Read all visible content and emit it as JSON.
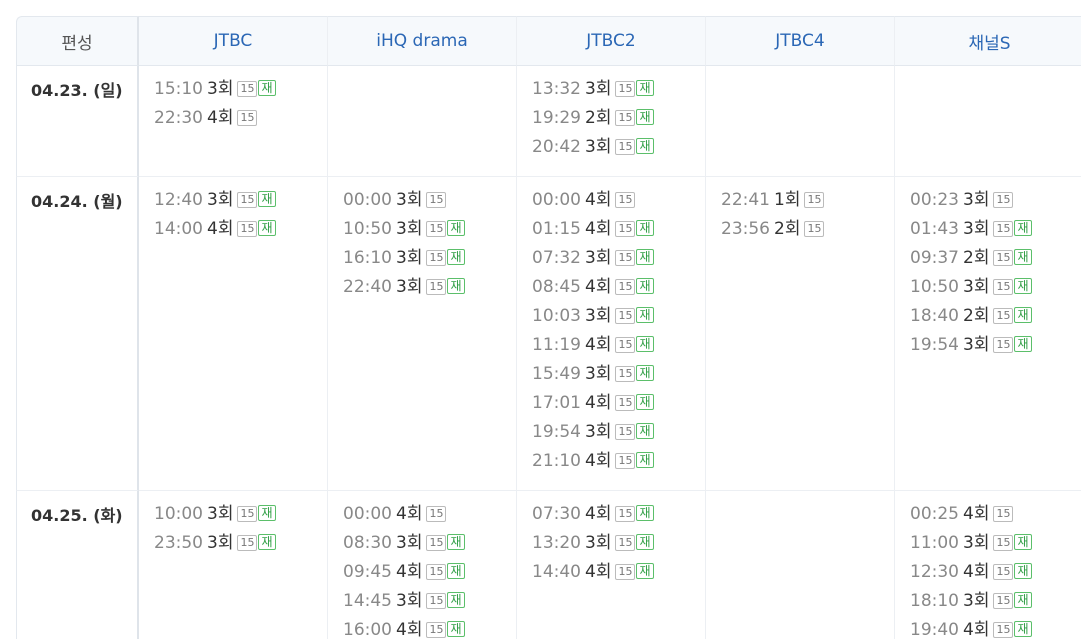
{
  "header": {
    "date_col": "편성",
    "channels": [
      "JTBC",
      "iHQ drama",
      "JTBC2",
      "JTBC4",
      "채널S"
    ]
  },
  "rows": [
    {
      "date": "04.23. (일)",
      "cells": [
        [
          {
            "time": "15:10",
            "ep": "3회",
            "rating": "15",
            "rerun": "재"
          },
          {
            "time": "22:30",
            "ep": "4회",
            "rating": "15"
          }
        ],
        [],
        [
          {
            "time": "13:32",
            "ep": "3회",
            "rating": "15",
            "rerun": "재"
          },
          {
            "time": "19:29",
            "ep": "2회",
            "rating": "15",
            "rerun": "재"
          },
          {
            "time": "20:42",
            "ep": "3회",
            "rating": "15",
            "rerun": "재"
          }
        ],
        [],
        []
      ]
    },
    {
      "date": "04.24. (월)",
      "cells": [
        [
          {
            "time": "12:40",
            "ep": "3회",
            "rating": "15",
            "rerun": "재"
          },
          {
            "time": "14:00",
            "ep": "4회",
            "rating": "15",
            "rerun": "재"
          }
        ],
        [
          {
            "time": "00:00",
            "ep": "3회",
            "rating": "15"
          },
          {
            "time": "10:50",
            "ep": "3회",
            "rating": "15",
            "rerun": "재"
          },
          {
            "time": "16:10",
            "ep": "3회",
            "rating": "15",
            "rerun": "재"
          },
          {
            "time": "22:40",
            "ep": "3회",
            "rating": "15",
            "rerun": "재"
          }
        ],
        [
          {
            "time": "00:00",
            "ep": "4회",
            "rating": "15"
          },
          {
            "time": "01:15",
            "ep": "4회",
            "rating": "15",
            "rerun": "재"
          },
          {
            "time": "07:32",
            "ep": "3회",
            "rating": "15",
            "rerun": "재"
          },
          {
            "time": "08:45",
            "ep": "4회",
            "rating": "15",
            "rerun": "재"
          },
          {
            "time": "10:03",
            "ep": "3회",
            "rating": "15",
            "rerun": "재"
          },
          {
            "time": "11:19",
            "ep": "4회",
            "rating": "15",
            "rerun": "재"
          },
          {
            "time": "15:49",
            "ep": "3회",
            "rating": "15",
            "rerun": "재"
          },
          {
            "time": "17:01",
            "ep": "4회",
            "rating": "15",
            "rerun": "재"
          },
          {
            "time": "19:54",
            "ep": "3회",
            "rating": "15",
            "rerun": "재"
          },
          {
            "time": "21:10",
            "ep": "4회",
            "rating": "15",
            "rerun": "재"
          }
        ],
        [
          {
            "time": "22:41",
            "ep": "1회",
            "rating": "15"
          },
          {
            "time": "23:56",
            "ep": "2회",
            "rating": "15"
          }
        ],
        [
          {
            "time": "00:23",
            "ep": "3회",
            "rating": "15"
          },
          {
            "time": "01:43",
            "ep": "3회",
            "rating": "15",
            "rerun": "재"
          },
          {
            "time": "09:37",
            "ep": "2회",
            "rating": "15",
            "rerun": "재"
          },
          {
            "time": "10:50",
            "ep": "3회",
            "rating": "15",
            "rerun": "재"
          },
          {
            "time": "18:40",
            "ep": "2회",
            "rating": "15",
            "rerun": "재"
          },
          {
            "time": "19:54",
            "ep": "3회",
            "rating": "15",
            "rerun": "재"
          }
        ]
      ]
    },
    {
      "date": "04.25. (화)",
      "cells": [
        [
          {
            "time": "10:00",
            "ep": "3회",
            "rating": "15",
            "rerun": "재"
          },
          {
            "time": "23:50",
            "ep": "3회",
            "rating": "15",
            "rerun": "재"
          }
        ],
        [
          {
            "time": "00:00",
            "ep": "4회",
            "rating": "15"
          },
          {
            "time": "08:30",
            "ep": "3회",
            "rating": "15",
            "rerun": "재"
          },
          {
            "time": "09:45",
            "ep": "4회",
            "rating": "15",
            "rerun": "재"
          },
          {
            "time": "14:45",
            "ep": "3회",
            "rating": "15",
            "rerun": "재"
          },
          {
            "time": "16:00",
            "ep": "4회",
            "rating": "15",
            "rerun": "재"
          }
        ],
        [
          {
            "time": "07:30",
            "ep": "4회",
            "rating": "15",
            "rerun": "재"
          },
          {
            "time": "13:20",
            "ep": "3회",
            "rating": "15",
            "rerun": "재"
          },
          {
            "time": "14:40",
            "ep": "4회",
            "rating": "15",
            "rerun": "재"
          }
        ],
        [],
        [
          {
            "time": "00:25",
            "ep": "4회",
            "rating": "15"
          },
          {
            "time": "11:00",
            "ep": "3회",
            "rating": "15",
            "rerun": "재"
          },
          {
            "time": "12:30",
            "ep": "4회",
            "rating": "15",
            "rerun": "재"
          },
          {
            "time": "18:10",
            "ep": "3회",
            "rating": "15",
            "rerun": "재"
          },
          {
            "time": "19:40",
            "ep": "4회",
            "rating": "15",
            "rerun": "재"
          }
        ]
      ]
    }
  ]
}
